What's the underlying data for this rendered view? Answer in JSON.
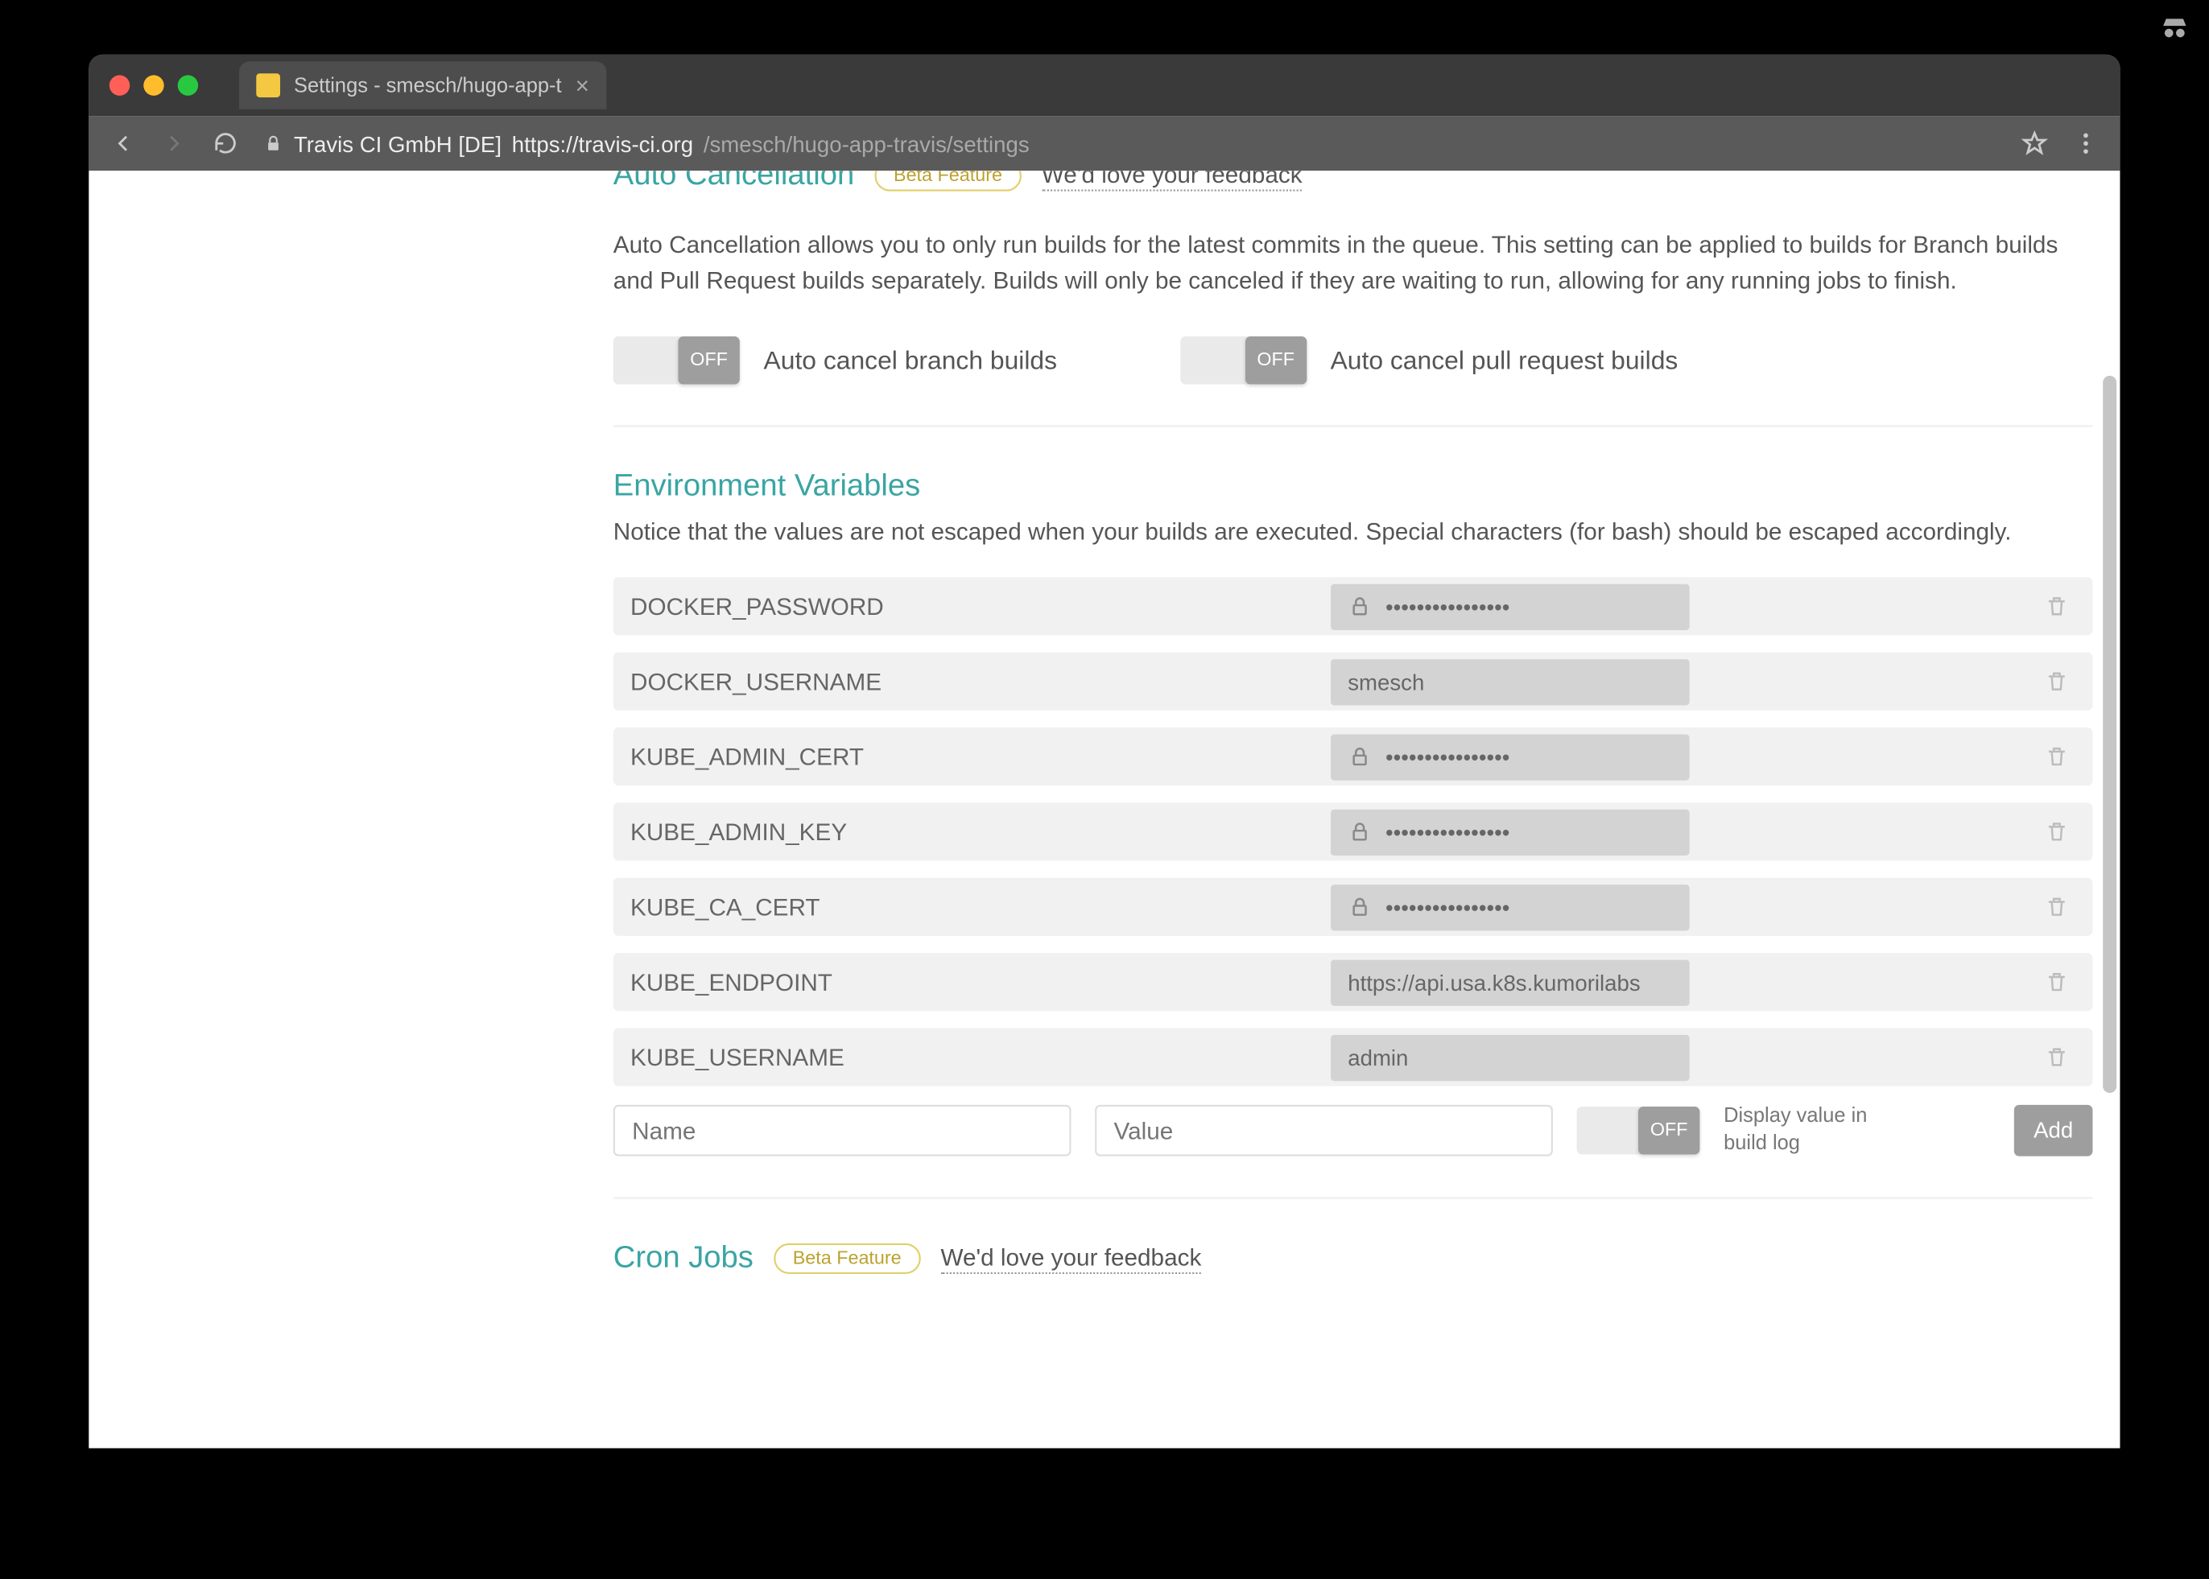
{
  "window": {
    "tab_title": "Settings - smesch/hugo-app-t",
    "site_label": "Travis CI GmbH [DE]",
    "url_host": "https://travis-ci.org",
    "url_path": "/smesch/hugo-app-travis/settings"
  },
  "auto_cancel": {
    "title": "Auto Cancellation",
    "beta": "Beta Feature",
    "feedback": "We'd love your feedback",
    "desc": "Auto Cancellation allows you to only run builds for the latest commits in the queue. This setting can be applied to builds for Branch builds and Pull Request builds separately. Builds will only be canceled if they are waiting to run, allowing for any running jobs to finish.",
    "off": "OFF",
    "branch_label": "Auto cancel branch builds",
    "pr_label": "Auto cancel pull request builds"
  },
  "env": {
    "title": "Environment Variables",
    "notice": "Notice that the values are not escaped when your builds are executed. Special characters (for bash) should be escaped accordingly.",
    "vars": [
      {
        "name": "DOCKER_PASSWORD",
        "value": "••••••••••••••••",
        "secret": true
      },
      {
        "name": "DOCKER_USERNAME",
        "value": "smesch",
        "secret": false
      },
      {
        "name": "KUBE_ADMIN_CERT",
        "value": "••••••••••••••••",
        "secret": true
      },
      {
        "name": "KUBE_ADMIN_KEY",
        "value": "••••••••••••••••",
        "secret": true
      },
      {
        "name": "KUBE_CA_CERT",
        "value": "••••••••••••••••",
        "secret": true
      },
      {
        "name": "KUBE_ENDPOINT",
        "value": "https://api.usa.k8s.kumorilabs",
        "secret": false
      },
      {
        "name": "KUBE_USERNAME",
        "value": "admin",
        "secret": false
      }
    ],
    "name_ph": "Name",
    "value_ph": "Value",
    "off": "OFF",
    "display_label": "Display value in build log",
    "add": "Add"
  },
  "cron": {
    "title": "Cron Jobs",
    "beta": "Beta Feature",
    "feedback": "We'd love your feedback"
  }
}
